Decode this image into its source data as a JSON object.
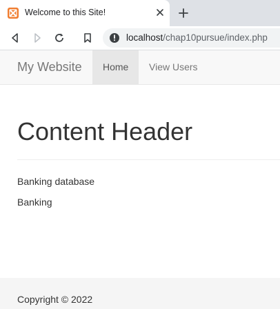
{
  "browser": {
    "tab_title": "Welcome to this Site!",
    "url_host": "localhost",
    "url_path": "/chap10pursue/index.php"
  },
  "navbar": {
    "brand": "My Website",
    "items": [
      {
        "label": "Home",
        "active": true
      },
      {
        "label": "View Users",
        "active": false
      }
    ]
  },
  "main": {
    "header": "Content Header",
    "paragraphs": [
      "Banking database",
      "Banking"
    ]
  },
  "footer": {
    "copyright": "Copyright © 2022"
  },
  "colors": {
    "favicon": "#f07c2e",
    "navbar_bg": "#f8f8f8",
    "nav_active_bg": "#e7e7e7",
    "footer_bg": "#f5f5f5"
  }
}
